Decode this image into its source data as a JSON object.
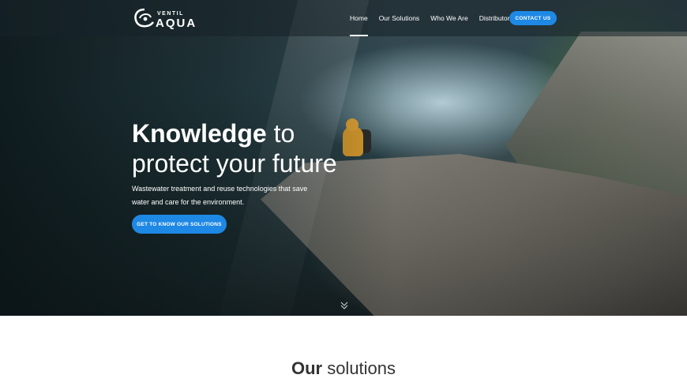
{
  "brand": {
    "logo_small": "VENTIL",
    "logo_big": "AQUA"
  },
  "nav": {
    "items": [
      {
        "label": "Home",
        "active": true
      },
      {
        "label": "Our Solutions",
        "active": false
      },
      {
        "label": "Who We Are",
        "active": false
      },
      {
        "label": "Distributors",
        "active": false
      }
    ],
    "contact_label": "CONTACT US"
  },
  "hero": {
    "title_strong": "Knowledge",
    "title_rest_1": " to",
    "title_line_2": "protect your future",
    "subtitle": "Wastewater treatment and reuse technologies that save water and care for the environment.",
    "cta_label": "GET TO KNOW OUR SOLUTIONS"
  },
  "solutions": {
    "title_strong": "Our",
    "title_rest": " solutions"
  },
  "colors": {
    "accent": "#1e88e5",
    "heading": "#333333"
  }
}
